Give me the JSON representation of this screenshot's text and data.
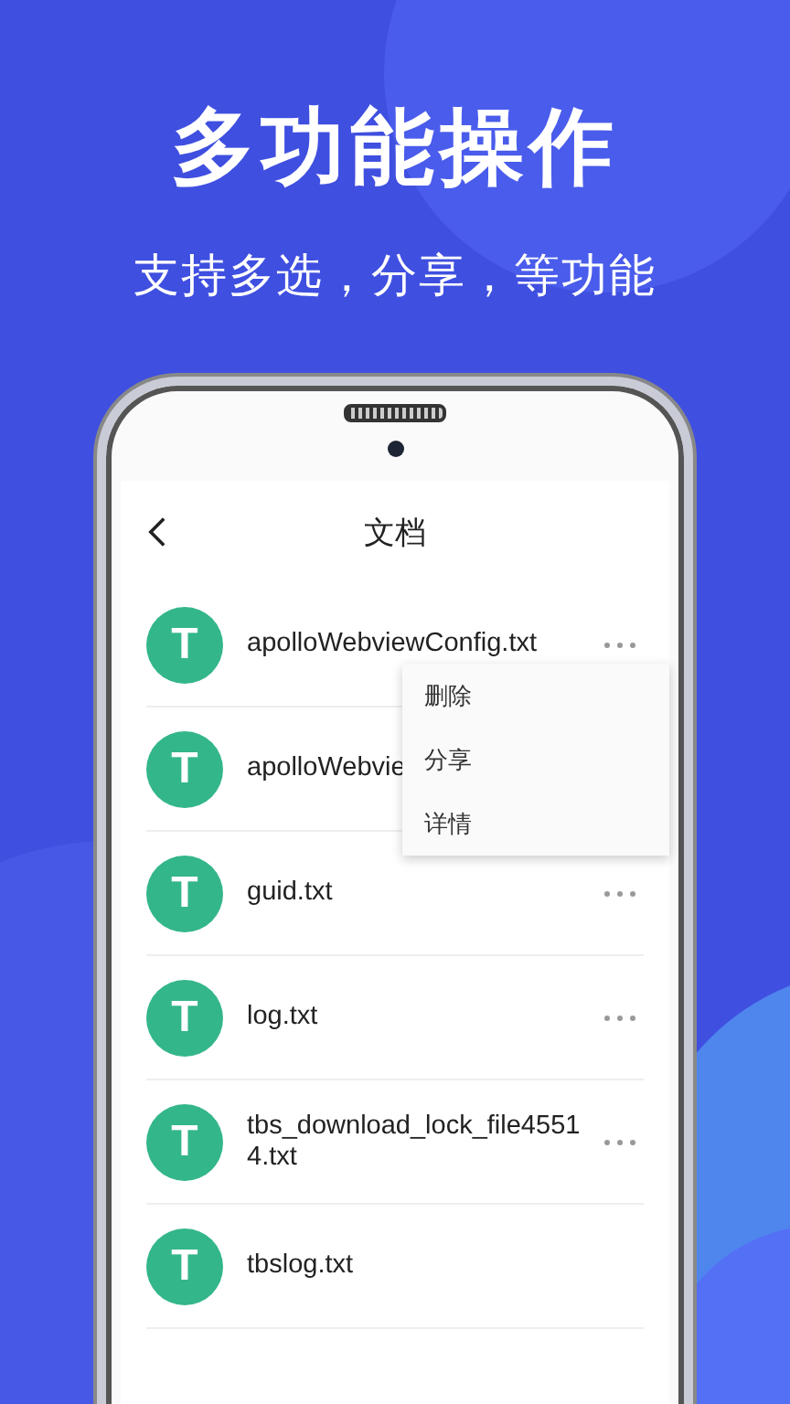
{
  "headline": "多功能操作",
  "subtitle": "支持多选，分享，等功能",
  "screen": {
    "title": "文档",
    "files": [
      {
        "letter": "T",
        "name": "apolloWebviewConfig.txt",
        "more_button": true
      },
      {
        "letter": "T",
        "name": "apolloWebvie",
        "more_button": false
      },
      {
        "letter": "T",
        "name": "guid.txt",
        "more_button": true
      },
      {
        "letter": "T",
        "name": "log.txt",
        "more_button": true
      },
      {
        "letter": "T",
        "name": "tbs_download_lock_file45514.txt",
        "more_button": true
      },
      {
        "letter": "T",
        "name": "tbslog.txt",
        "more_button": false
      }
    ],
    "menu": [
      "删除",
      "分享",
      "详情"
    ]
  }
}
